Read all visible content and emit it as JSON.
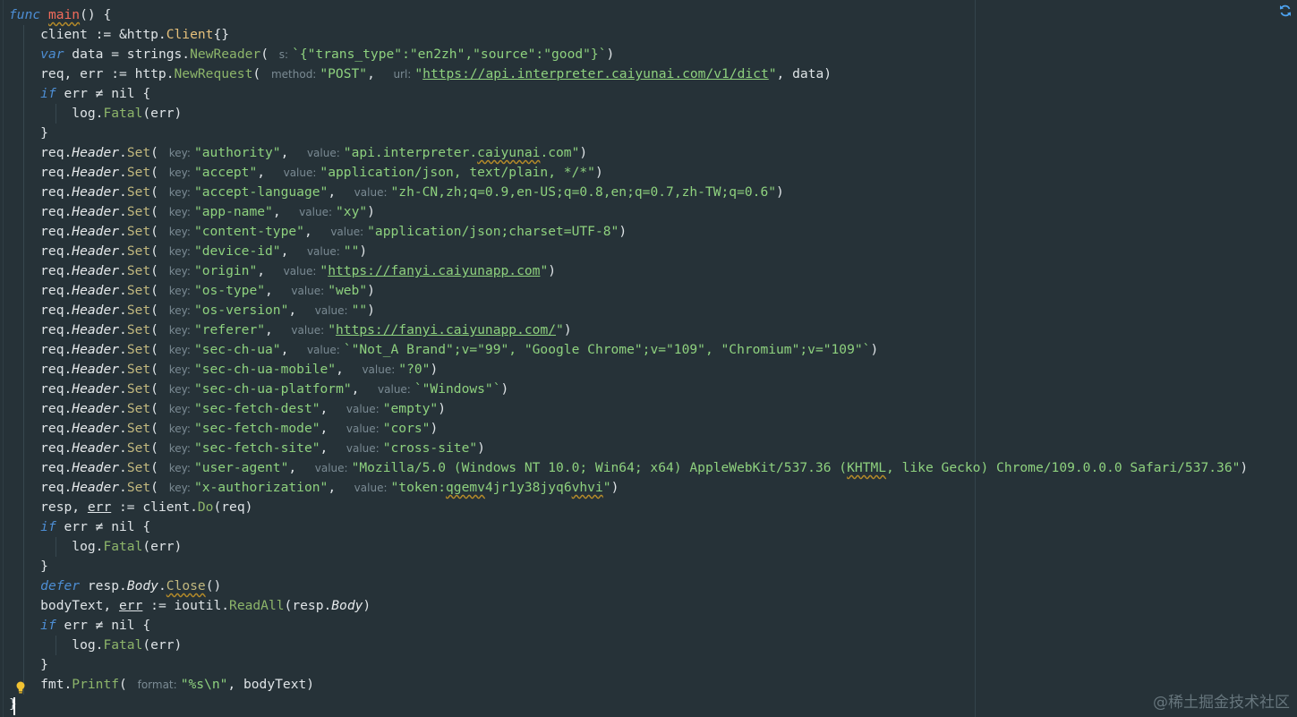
{
  "editor": {
    "watermark": "@稀土掘金技术社区"
  },
  "code_lines": [
    [
      [
        "kw",
        "func"
      ],
      [
        "plain",
        " "
      ],
      [
        "fnname",
        "main"
      ],
      [
        "plain",
        "() {"
      ]
    ],
    [
      [
        "plain",
        "    client := &http."
      ],
      [
        "typ",
        "Client"
      ],
      [
        "plain",
        "{}"
      ]
    ],
    [
      [
        "plain",
        "    "
      ],
      [
        "kw",
        "var"
      ],
      [
        "plain",
        " data = strings."
      ],
      [
        "fn",
        "NewReader"
      ],
      [
        "plain",
        "( "
      ],
      [
        "hint",
        "s:"
      ],
      [
        "str",
        "`{\"trans_type\":\"en2zh\",\"source\":\"good\"}`"
      ],
      [
        "plain",
        ")"
      ]
    ],
    [
      [
        "plain",
        "    req, err := http."
      ],
      [
        "fn",
        "NewRequest"
      ],
      [
        "plain",
        "( "
      ],
      [
        "hint",
        "method:"
      ],
      [
        "str",
        "\"POST\""
      ],
      [
        "plain",
        ",  "
      ],
      [
        "hint",
        "url:"
      ],
      [
        "str",
        "\""
      ],
      [
        "strlink",
        "https://api.interpreter.caiyunai.com/v1/dict"
      ],
      [
        "str",
        "\""
      ],
      [
        "plain",
        ", data)"
      ]
    ],
    [
      [
        "plain",
        "    "
      ],
      [
        "kw",
        "if"
      ],
      [
        "plain",
        " err ≠ nil {"
      ]
    ],
    [
      [
        "plain",
        "        log."
      ],
      [
        "fn",
        "Fatal"
      ],
      [
        "plain",
        "(err)"
      ]
    ],
    [
      [
        "plain",
        "    }"
      ]
    ],
    [
      [
        "plain",
        "    req."
      ],
      [
        "field",
        "Header"
      ],
      [
        "plain",
        "."
      ],
      [
        "meth",
        "Set"
      ],
      [
        "plain",
        "( "
      ],
      [
        "hint",
        "key:"
      ],
      [
        "str",
        "\"authority\""
      ],
      [
        "plain",
        ",  "
      ],
      [
        "hint",
        "value:"
      ],
      [
        "str",
        "\"api.interpreter."
      ],
      [
        "strwavy",
        "caiyunai"
      ],
      [
        "str",
        ".com\""
      ],
      [
        "plain",
        ")"
      ]
    ],
    [
      [
        "plain",
        "    req."
      ],
      [
        "field",
        "Header"
      ],
      [
        "plain",
        "."
      ],
      [
        "meth",
        "Set"
      ],
      [
        "plain",
        "( "
      ],
      [
        "hint",
        "key:"
      ],
      [
        "str",
        "\"accept\""
      ],
      [
        "plain",
        ",  "
      ],
      [
        "hint",
        "value:"
      ],
      [
        "str",
        "\"application/json, text/plain, */*\""
      ],
      [
        "plain",
        ")"
      ]
    ],
    [
      [
        "plain",
        "    req."
      ],
      [
        "field",
        "Header"
      ],
      [
        "plain",
        "."
      ],
      [
        "meth",
        "Set"
      ],
      [
        "plain",
        "( "
      ],
      [
        "hint",
        "key:"
      ],
      [
        "str",
        "\"accept-language\""
      ],
      [
        "plain",
        ",  "
      ],
      [
        "hint",
        "value:"
      ],
      [
        "str",
        "\"zh-CN,zh;q=0.9,en-US;q=0.8,en;q=0.7,zh-TW;q=0.6\""
      ],
      [
        "plain",
        ")"
      ]
    ],
    [
      [
        "plain",
        "    req."
      ],
      [
        "field",
        "Header"
      ],
      [
        "plain",
        "."
      ],
      [
        "meth",
        "Set"
      ],
      [
        "plain",
        "( "
      ],
      [
        "hint",
        "key:"
      ],
      [
        "str",
        "\"app-name\""
      ],
      [
        "plain",
        ",  "
      ],
      [
        "hint",
        "value:"
      ],
      [
        "str",
        "\"xy\""
      ],
      [
        "plain",
        ")"
      ]
    ],
    [
      [
        "plain",
        "    req."
      ],
      [
        "field",
        "Header"
      ],
      [
        "plain",
        "."
      ],
      [
        "meth",
        "Set"
      ],
      [
        "plain",
        "( "
      ],
      [
        "hint",
        "key:"
      ],
      [
        "str",
        "\"content-type\""
      ],
      [
        "plain",
        ",  "
      ],
      [
        "hint",
        "value:"
      ],
      [
        "str",
        "\"application/json;charset=UTF-8\""
      ],
      [
        "plain",
        ")"
      ]
    ],
    [
      [
        "plain",
        "    req."
      ],
      [
        "field",
        "Header"
      ],
      [
        "plain",
        "."
      ],
      [
        "meth",
        "Set"
      ],
      [
        "plain",
        "( "
      ],
      [
        "hint",
        "key:"
      ],
      [
        "str",
        "\"device-id\""
      ],
      [
        "plain",
        ",  "
      ],
      [
        "hint",
        "value:"
      ],
      [
        "str",
        "\"\""
      ],
      [
        "plain",
        ")"
      ]
    ],
    [
      [
        "plain",
        "    req."
      ],
      [
        "field",
        "Header"
      ],
      [
        "plain",
        "."
      ],
      [
        "meth",
        "Set"
      ],
      [
        "plain",
        "( "
      ],
      [
        "hint",
        "key:"
      ],
      [
        "str",
        "\"origin\""
      ],
      [
        "plain",
        ",  "
      ],
      [
        "hint",
        "value:"
      ],
      [
        "str",
        "\""
      ],
      [
        "strlink",
        "https://fanyi.caiyunapp.com"
      ],
      [
        "str",
        "\""
      ],
      [
        "plain",
        ")"
      ]
    ],
    [
      [
        "plain",
        "    req."
      ],
      [
        "field",
        "Header"
      ],
      [
        "plain",
        "."
      ],
      [
        "meth",
        "Set"
      ],
      [
        "plain",
        "( "
      ],
      [
        "hint",
        "key:"
      ],
      [
        "str",
        "\"os-type\""
      ],
      [
        "plain",
        ",  "
      ],
      [
        "hint",
        "value:"
      ],
      [
        "str",
        "\"web\""
      ],
      [
        "plain",
        ")"
      ]
    ],
    [
      [
        "plain",
        "    req."
      ],
      [
        "field",
        "Header"
      ],
      [
        "plain",
        "."
      ],
      [
        "meth",
        "Set"
      ],
      [
        "plain",
        "( "
      ],
      [
        "hint",
        "key:"
      ],
      [
        "str",
        "\"os-version\""
      ],
      [
        "plain",
        ",  "
      ],
      [
        "hint",
        "value:"
      ],
      [
        "str",
        "\"\""
      ],
      [
        "plain",
        ")"
      ]
    ],
    [
      [
        "plain",
        "    req."
      ],
      [
        "field",
        "Header"
      ],
      [
        "plain",
        "."
      ],
      [
        "meth",
        "Set"
      ],
      [
        "plain",
        "( "
      ],
      [
        "hint",
        "key:"
      ],
      [
        "str",
        "\"referer\""
      ],
      [
        "plain",
        ",  "
      ],
      [
        "hint",
        "value:"
      ],
      [
        "str",
        "\""
      ],
      [
        "strlink",
        "https://fanyi.caiyunapp.com/"
      ],
      [
        "str",
        "\""
      ],
      [
        "plain",
        ")"
      ]
    ],
    [
      [
        "plain",
        "    req."
      ],
      [
        "field",
        "Header"
      ],
      [
        "plain",
        "."
      ],
      [
        "meth",
        "Set"
      ],
      [
        "plain",
        "( "
      ],
      [
        "hint",
        "key:"
      ],
      [
        "str",
        "\"sec-ch-ua\""
      ],
      [
        "plain",
        ",  "
      ],
      [
        "hint",
        "value:"
      ],
      [
        "str",
        "`\"Not_A Brand\";v=\"99\", \"Google Chrome\";v=\"109\", \"Chromium\";v=\"109\"`"
      ],
      [
        "plain",
        ")"
      ]
    ],
    [
      [
        "plain",
        "    req."
      ],
      [
        "field",
        "Header"
      ],
      [
        "plain",
        "."
      ],
      [
        "meth",
        "Set"
      ],
      [
        "plain",
        "( "
      ],
      [
        "hint",
        "key:"
      ],
      [
        "str",
        "\"sec-ch-ua-mobile\""
      ],
      [
        "plain",
        ",  "
      ],
      [
        "hint",
        "value:"
      ],
      [
        "str",
        "\"?0\""
      ],
      [
        "plain",
        ")"
      ]
    ],
    [
      [
        "plain",
        "    req."
      ],
      [
        "field",
        "Header"
      ],
      [
        "plain",
        "."
      ],
      [
        "meth",
        "Set"
      ],
      [
        "plain",
        "( "
      ],
      [
        "hint",
        "key:"
      ],
      [
        "str",
        "\"sec-ch-ua-platform\""
      ],
      [
        "plain",
        ",  "
      ],
      [
        "hint",
        "value:"
      ],
      [
        "str",
        "`\"Windows\"`"
      ],
      [
        "plain",
        ")"
      ]
    ],
    [
      [
        "plain",
        "    req."
      ],
      [
        "field",
        "Header"
      ],
      [
        "plain",
        "."
      ],
      [
        "meth",
        "Set"
      ],
      [
        "plain",
        "( "
      ],
      [
        "hint",
        "key:"
      ],
      [
        "str",
        "\"sec-fetch-dest\""
      ],
      [
        "plain",
        ",  "
      ],
      [
        "hint",
        "value:"
      ],
      [
        "str",
        "\"empty\""
      ],
      [
        "plain",
        ")"
      ]
    ],
    [
      [
        "plain",
        "    req."
      ],
      [
        "field",
        "Header"
      ],
      [
        "plain",
        "."
      ],
      [
        "meth",
        "Set"
      ],
      [
        "plain",
        "( "
      ],
      [
        "hint",
        "key:"
      ],
      [
        "str",
        "\"sec-fetch-mode\""
      ],
      [
        "plain",
        ",  "
      ],
      [
        "hint",
        "value:"
      ],
      [
        "str",
        "\"cors\""
      ],
      [
        "plain",
        ")"
      ]
    ],
    [
      [
        "plain",
        "    req."
      ],
      [
        "field",
        "Header"
      ],
      [
        "plain",
        "."
      ],
      [
        "meth",
        "Set"
      ],
      [
        "plain",
        "( "
      ],
      [
        "hint",
        "key:"
      ],
      [
        "str",
        "\"sec-fetch-site\""
      ],
      [
        "plain",
        ",  "
      ],
      [
        "hint",
        "value:"
      ],
      [
        "str",
        "\"cross-site\""
      ],
      [
        "plain",
        ")"
      ]
    ],
    [
      [
        "plain",
        "    req."
      ],
      [
        "field",
        "Header"
      ],
      [
        "plain",
        "."
      ],
      [
        "meth",
        "Set"
      ],
      [
        "plain",
        "( "
      ],
      [
        "hint",
        "key:"
      ],
      [
        "str",
        "\"user-agent\""
      ],
      [
        "plain",
        ",  "
      ],
      [
        "hint",
        "value:"
      ],
      [
        "str",
        "\"Mozilla/5.0 (Windows NT 10.0; Win64; x64) AppleWebKit/537.36 ("
      ],
      [
        "strwavy",
        "KHTML"
      ],
      [
        "str",
        ", like Gecko) Chrome/109.0.0.0 Safari/537.36\""
      ],
      [
        "plain",
        ")"
      ]
    ],
    [
      [
        "plain",
        "    req."
      ],
      [
        "field",
        "Header"
      ],
      [
        "plain",
        "."
      ],
      [
        "meth",
        "Set"
      ],
      [
        "plain",
        "( "
      ],
      [
        "hint",
        "key:"
      ],
      [
        "str",
        "\"x-authorization\""
      ],
      [
        "plain",
        ",  "
      ],
      [
        "hint",
        "value:"
      ],
      [
        "str",
        "\"token:"
      ],
      [
        "strwavy",
        "qgemv"
      ],
      [
        "str",
        "4jr1y38jyq6"
      ],
      [
        "strwavy",
        "vhvi"
      ],
      [
        "str",
        "\""
      ],
      [
        "plain",
        ")"
      ]
    ],
    [
      [
        "plain",
        "    resp, "
      ],
      [
        "errvar",
        "err"
      ],
      [
        "plain",
        " := client."
      ],
      [
        "fn",
        "Do"
      ],
      [
        "plain",
        "(req)"
      ]
    ],
    [
      [
        "plain",
        "    "
      ],
      [
        "kw",
        "if"
      ],
      [
        "plain",
        " err ≠ nil {"
      ]
    ],
    [
      [
        "plain",
        "        log."
      ],
      [
        "fn",
        "Fatal"
      ],
      [
        "plain",
        "(err)"
      ]
    ],
    [
      [
        "plain",
        "    }"
      ]
    ],
    [
      [
        "plain",
        "    "
      ],
      [
        "kw",
        "defer"
      ],
      [
        "plain",
        " resp."
      ],
      [
        "field",
        "Body"
      ],
      [
        "plain",
        "."
      ],
      [
        "methwavy",
        "Close"
      ],
      [
        "plain",
        "()"
      ]
    ],
    [
      [
        "plain",
        "    bodyText, "
      ],
      [
        "errvar",
        "err"
      ],
      [
        "plain",
        " := ioutil."
      ],
      [
        "fn",
        "ReadAll"
      ],
      [
        "plain",
        "(resp."
      ],
      [
        "field",
        "Body"
      ],
      [
        "plain",
        ")"
      ]
    ],
    [
      [
        "plain",
        "    "
      ],
      [
        "kw",
        "if"
      ],
      [
        "plain",
        " err ≠ nil {"
      ]
    ],
    [
      [
        "plain",
        "        log."
      ],
      [
        "fn",
        "Fatal"
      ],
      [
        "plain",
        "(err)"
      ]
    ],
    [
      [
        "plain",
        "    }"
      ]
    ],
    [
      [
        "plain",
        "    fmt."
      ],
      [
        "fn",
        "Printf"
      ],
      [
        "plain",
        "( "
      ],
      [
        "hint",
        "format:"
      ],
      [
        "str",
        "\"%s\\n\""
      ],
      [
        "plain",
        ", bodyText)"
      ]
    ],
    [
      [
        "plain",
        "}"
      ]
    ]
  ]
}
